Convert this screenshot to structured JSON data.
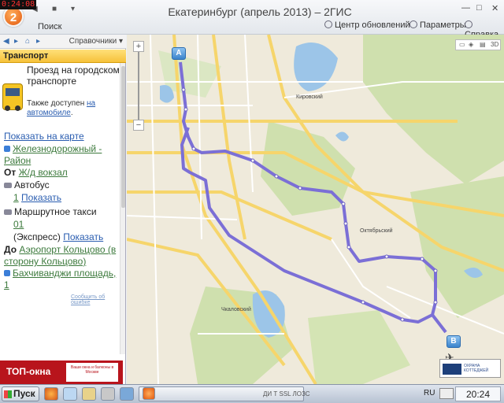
{
  "recording_timer": "0:24:08",
  "window": {
    "title": "Екатеринбург (апрель 2013) – 2ГИС",
    "search_label": "Поиск",
    "updates_label": "Центр обновлений",
    "params_label": "Параметры",
    "help_label": "Справка"
  },
  "panel": {
    "ref_label": "Справочники",
    "section_title": "Транспорт",
    "heading": "Проезд на городском транспорте",
    "also_text": "Также доступен",
    "also_link": "на автомобиле",
    "also_suffix": ".",
    "show_on_map": "Показать на карте",
    "from_district": "Железнодорожный - Район",
    "from_label": "От",
    "from_value": "Ж/д вокзал",
    "bus_label": "Автобус",
    "bus_number": "1",
    "show_label": "Показать",
    "minibus_label": "Маршрутное такси",
    "minibus_number": "01",
    "minibus_type": "(Экспресс)",
    "to_label": "До",
    "to_value": "Аэропорт Кольцово (в сторону Кольцово)",
    "to_address": "Бахчиванджи площадь, 1",
    "edit_link": "Сообщить об ошибке",
    "ad_text": "ТОП-окна",
    "ad_sub": "Ваши окна и балконы в Москве"
  },
  "map": {
    "pin_a": "A",
    "pin_b": "B",
    "place_kirovsky": "Кировский",
    "place_oktyabrsky": "Октябрьский",
    "place_chkalovsky": "Чкаловский",
    "tools_3d": "3D",
    "ad_text": "ОХРАНА КОТТЕДЖЕЙ"
  },
  "taskbar": {
    "start_label": "Пуск",
    "lang": "RU",
    "clock": "20:24",
    "task_label": "ДИ Т SSL ЛОЗС"
  }
}
